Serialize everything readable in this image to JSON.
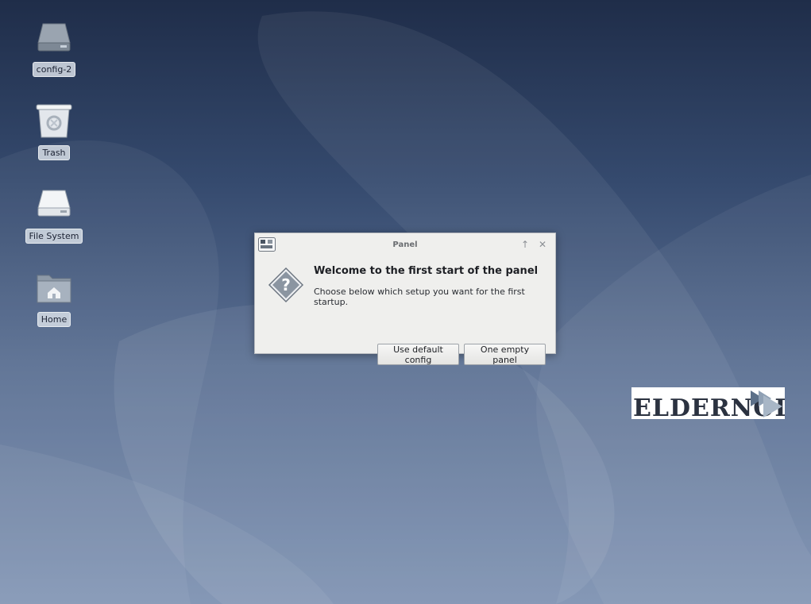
{
  "desktop": {
    "icons": [
      {
        "label": "config-2",
        "icon": "drive-icon"
      },
      {
        "label": "Trash",
        "icon": "trash-icon"
      },
      {
        "label": "File System",
        "icon": "drive-icon"
      },
      {
        "label": "Home",
        "icon": "home-folder-icon"
      }
    ]
  },
  "dialog": {
    "title": "Panel",
    "heading": "Welcome to the first start of the panel",
    "message": "Choose below which setup you want for the first startup.",
    "buttons": {
      "default_config": "Use default config",
      "empty_panel": "One empty panel"
    },
    "titlebar_icons": [
      "panel-app-icon",
      "up-arrow-icon",
      "close-icon"
    ],
    "body_icon": "question-icon"
  },
  "watermark": {
    "text": "ELDERNODE"
  },
  "colors": {
    "desktop_top": "#1f2d49",
    "desktop_bottom": "#7e92b2",
    "dialog_bg": "#efefed"
  }
}
